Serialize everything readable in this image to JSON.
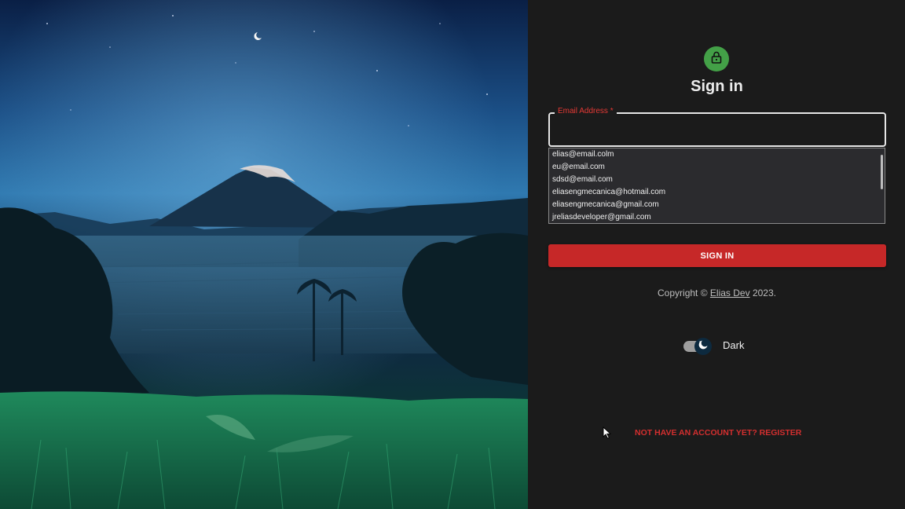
{
  "header": {
    "title": "Sign in"
  },
  "email_field": {
    "label": "Email Address *",
    "value": ""
  },
  "autocomplete": {
    "options": [
      "elias@email.colm",
      "eu@email.com",
      "sdsd@email.com",
      "eliasengmecanica@hotmail.com",
      "eliasengmecanica@gmail.com",
      "jreliasdeveloper@gmail.com"
    ]
  },
  "signin_button": {
    "label": "SIGN IN"
  },
  "footer": {
    "copyright_prefix": "Copyright ©",
    "author_link": "Elias Dev",
    "copyright_suffix": "2023."
  },
  "theme_toggle": {
    "label": "Dark",
    "checked": true
  },
  "register_link": {
    "label": "NOT HAVE AN ACCOUNT YET? REGISTER"
  },
  "colors": {
    "accent": "#c62828",
    "lock_badge": "#43a047",
    "panel_bg": "#1b1b1b"
  },
  "icons": {
    "lock": "lock-icon",
    "moon": "moon-icon"
  }
}
